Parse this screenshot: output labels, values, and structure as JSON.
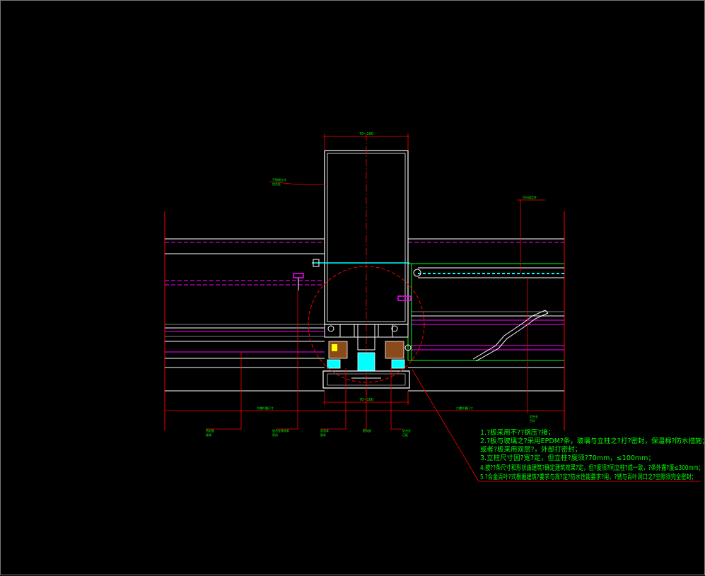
{
  "drawing": {
    "dim_top": "70~100",
    "dim_bottom": "70~100",
    "label_left_bottom": "大樓外牆尺寸",
    "label_right_bottom": "大樓外牆尺寸",
    "label_column": "不锈钢立柱",
    "label_column_sub": "铝合金",
    "label_top_right": "百叶固定件",
    "label_right_mid": "铝合金",
    "label_right_mid_sub": "百叶",
    "label_callouts": [
      "密封胶",
      "铝合金装饰条",
      "发泡条",
      "结构胶",
      "铝合金"
    ],
    "label_callouts_sub": [
      "玻璃",
      "密封",
      "胶条",
      "",
      "压板"
    ]
  },
  "notes": [
    "1.?板采用不??钢压?接；",
    "2.?板与玻璃之?采用EPDM?条，玻璃与立柱之?打?密封，保温棉?防水措施；",
    "   或者?板采用双层?，外部打密封；",
    "3.立柱尺寸因?宽?定，但立柱?度须?70mm，≤100mm；",
    "4.按??条尺寸和形状由建筑?确定建筑效果?定，但?度须?同立柱?成一致，?条外露?度≤300mm；",
    "5.?合金百叶?式根据建筑?要求与规?定?防水性能要求?用，?锈与百叶洞口之?空隙须完全密封；"
  ],
  "colors": {
    "background": "#000000",
    "white": "#ffffff",
    "red": "#ff0000",
    "magenta": "#ff00ff",
    "cyan": "#00ffff",
    "green": "#00ff00",
    "yellow": "#ffff00",
    "brown": "#8b4a1a",
    "gray": "#808080"
  }
}
